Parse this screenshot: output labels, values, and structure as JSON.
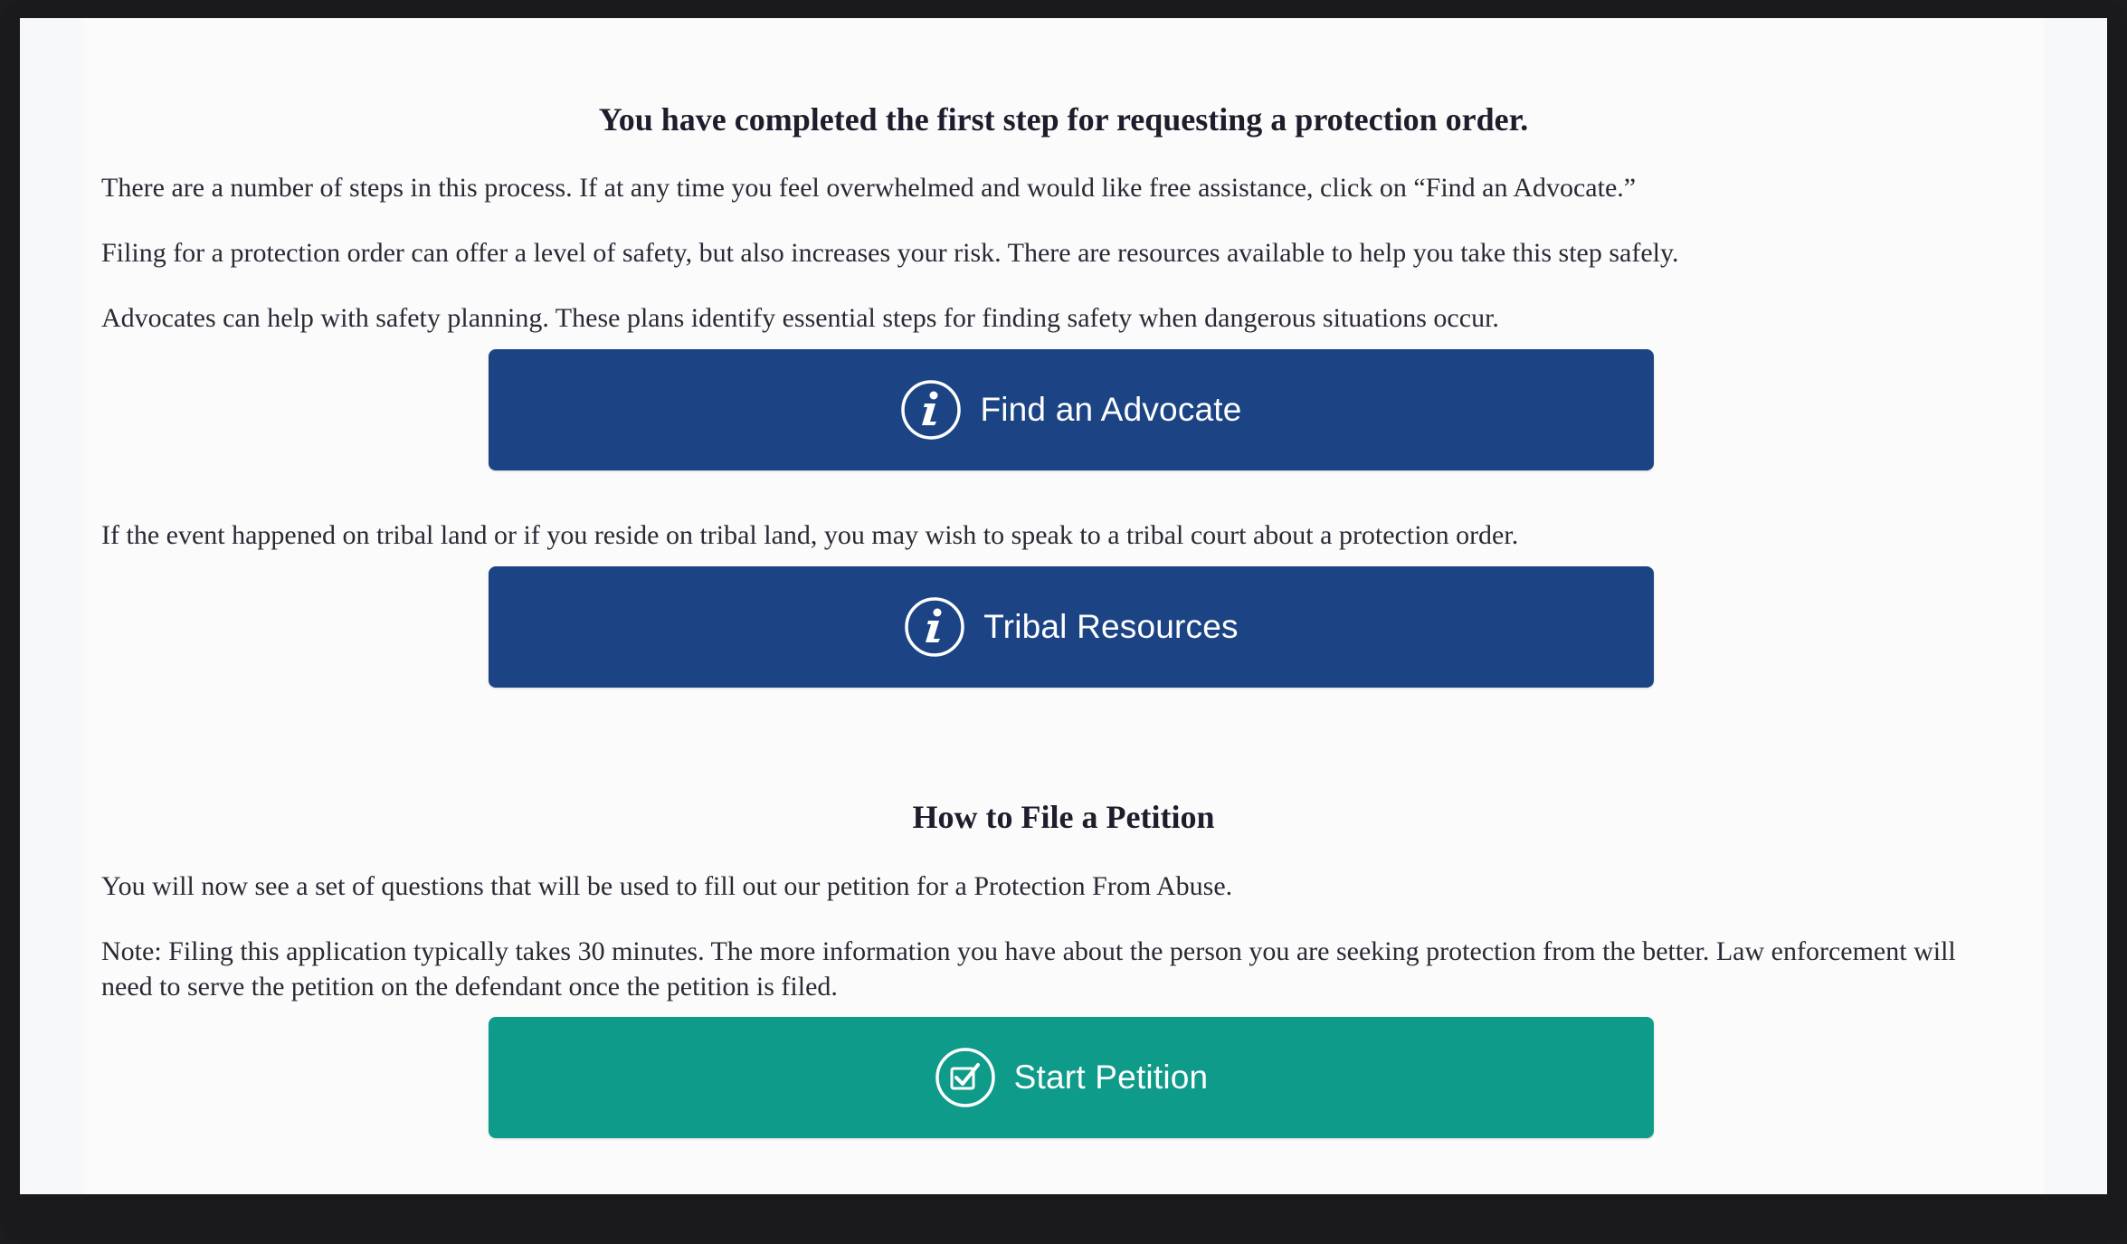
{
  "main": {
    "heading": "You have completed the first step for requesting a protection order.",
    "intro_paragraphs": [
      "There are a number of steps in this process.  If at any time you feel overwhelmed and would like free assistance, click on “Find an Advocate.”",
      "Filing for a protection order can offer a level of safety, but also increases your risk. There are resources available to help you take this step safely.",
      "Advocates can help with safety planning. These plans identify essential steps for finding safety when dangerous situations occur."
    ],
    "find_advocate_button": {
      "label": "Find an Advocate",
      "icon": "info-icon"
    },
    "tribal_paragraph": "If the event happened on tribal land or if you reside on tribal land, you may wish to speak to a tribal court about a protection order.",
    "tribal_resources_button": {
      "label": "Tribal Resources",
      "icon": "info-icon"
    },
    "petition_heading": "How to File a Petition",
    "petition_paragraph": "You will now see a set of questions that will be used to fill out our petition for a Protection From Abuse.",
    "note_paragraph": "Note: Filing this application typically takes 30 minutes. The more information you have about the person you are seeking protection from the better.  Law enforcement will need to serve the petition on the defendant once the petition is filed.",
    "start_petition_button": {
      "label": "Start Petition",
      "icon": "checkbox-icon"
    }
  },
  "colors": {
    "primary_button": "#1c4485",
    "start_button": "#0f9b8a",
    "text": "#2a2a35"
  }
}
